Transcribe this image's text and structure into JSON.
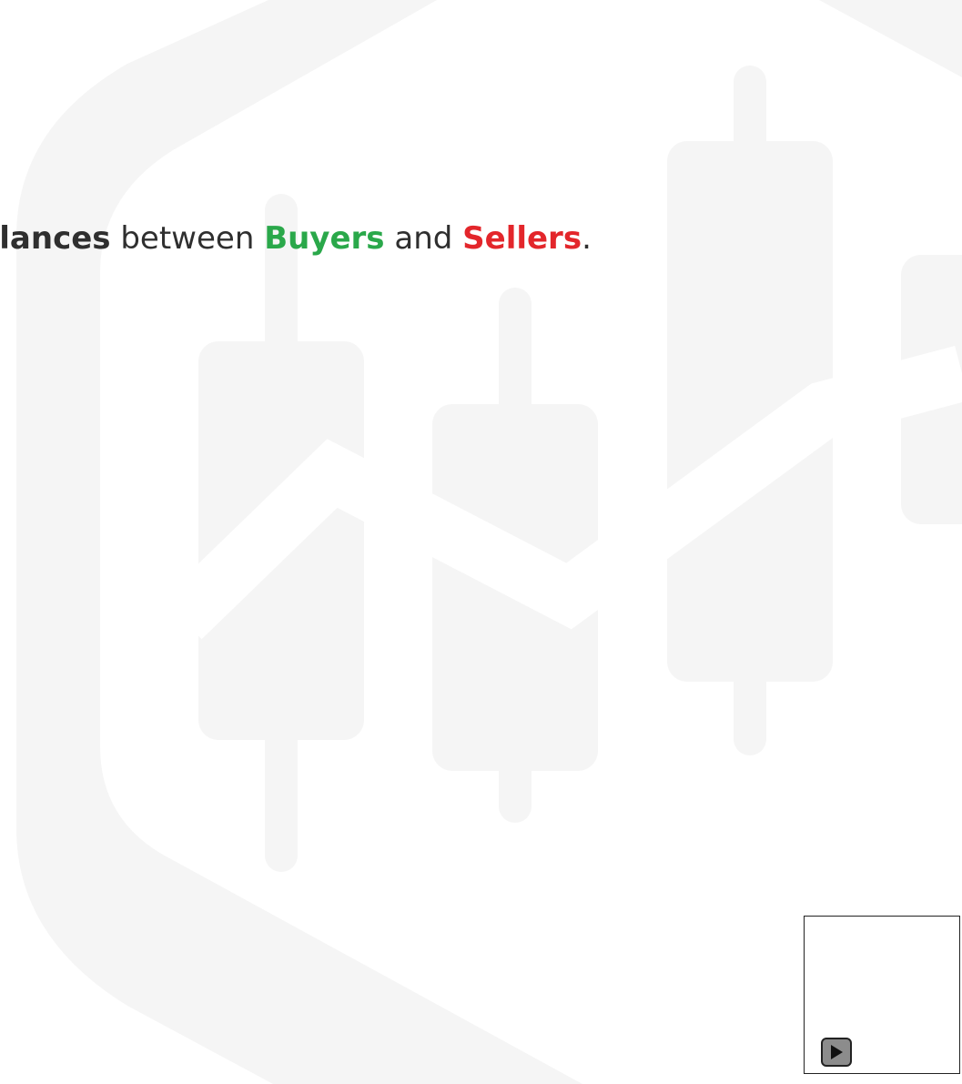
{
  "headline": {
    "part1": "balances",
    "part2": " between ",
    "part3": "Buyers",
    "part4": " and ",
    "part5": "Sellers",
    "part6": "."
  },
  "colors": {
    "buyers": "#2aa84a",
    "sellers": "#e3262b",
    "watermark": "#f5f5f5"
  },
  "icons": {
    "watermark": "candlestick-logo-icon",
    "play": "play-icon"
  }
}
